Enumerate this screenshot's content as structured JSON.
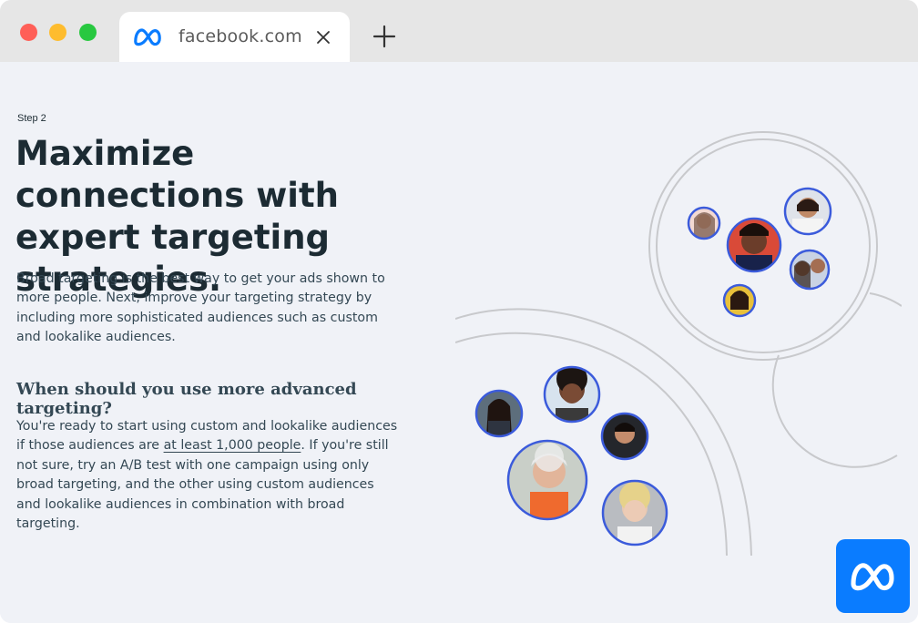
{
  "browser": {
    "tab_title": "facebook.com",
    "tab_icon": "meta-logo-icon",
    "close_icon": "close-icon",
    "new_tab_icon": "plus-icon"
  },
  "article": {
    "step": "Step 2",
    "heading": "Maximize connections with expert targeting strategies.",
    "para1": "Broad targeting is the best way to get your ads shown to more people. Next, improve your targeting strategy by including more sophisticated audiences such as custom and lookalike audiences.",
    "subheading": "When should you use more advanced targeting?",
    "para2_before": "You're ready to start using custom and lookalike audiences if those audiences are ",
    "para2_link": "at least 1,000 people",
    "para2_after": ". If you're still not sure, try an A/B test with one campaign using only broad targeting, and the other using custom audiences and lookalike audiences in combination with broad targeting."
  },
  "badge": {
    "icon": "meta-logo-icon"
  },
  "colors": {
    "accent": "#0a7cff",
    "avatar_ring": "#3b5bdb",
    "text": "#1c2b33"
  }
}
